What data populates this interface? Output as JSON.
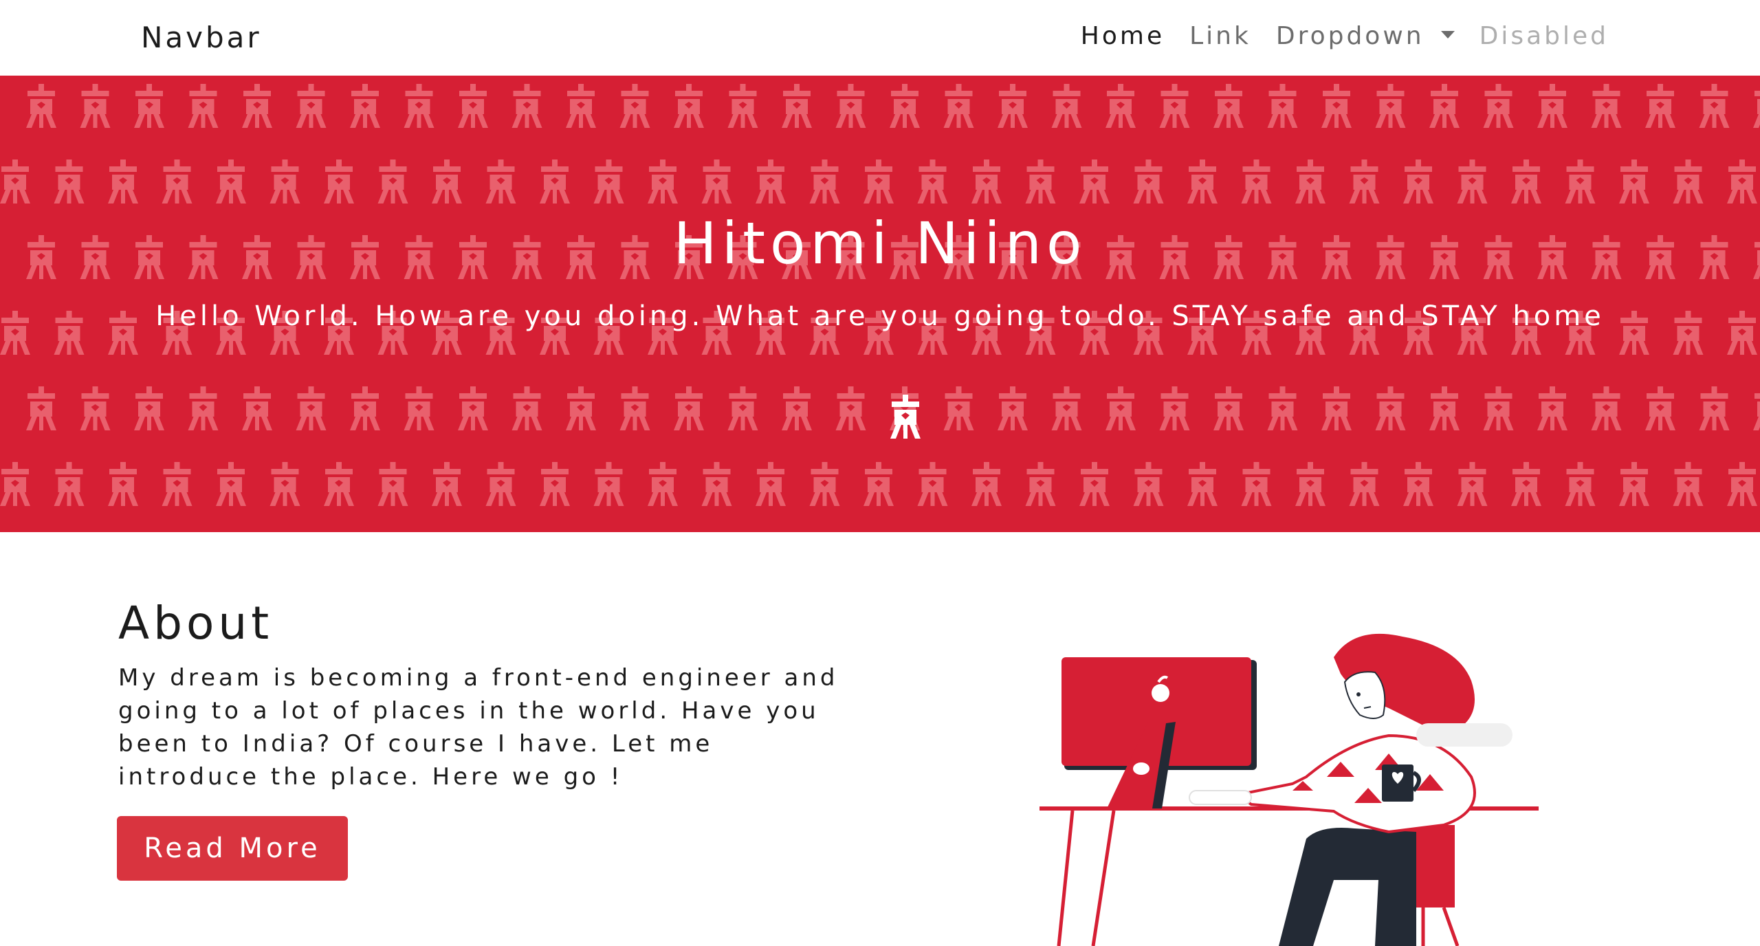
{
  "navbar": {
    "brand": "Navbar",
    "links": [
      {
        "label": "Home",
        "state": "active"
      },
      {
        "label": "Link",
        "state": "normal"
      },
      {
        "label": "Dropdown",
        "state": "dropdown"
      },
      {
        "label": "Disabled",
        "state": "disabled"
      }
    ]
  },
  "hero": {
    "title": "Hitomi Niino",
    "subtitle": "Hello World. How are you doing. What are you going to do. STAY safe and STAY home",
    "background_color": "#d61f34",
    "pattern_icon": "tower-glyph-icon"
  },
  "about": {
    "title": "About",
    "text": "My dream is becoming a front-end engineer and going to a lot of places in the world. Have you been to India? Of course I have. Let me introduce the place. Here we go !",
    "button_label": "Read More",
    "button_color": "#d9343f",
    "illustration": "woman-at-computer-illustration"
  },
  "colors": {
    "accent": "#d61f34",
    "dark": "#232a35"
  }
}
